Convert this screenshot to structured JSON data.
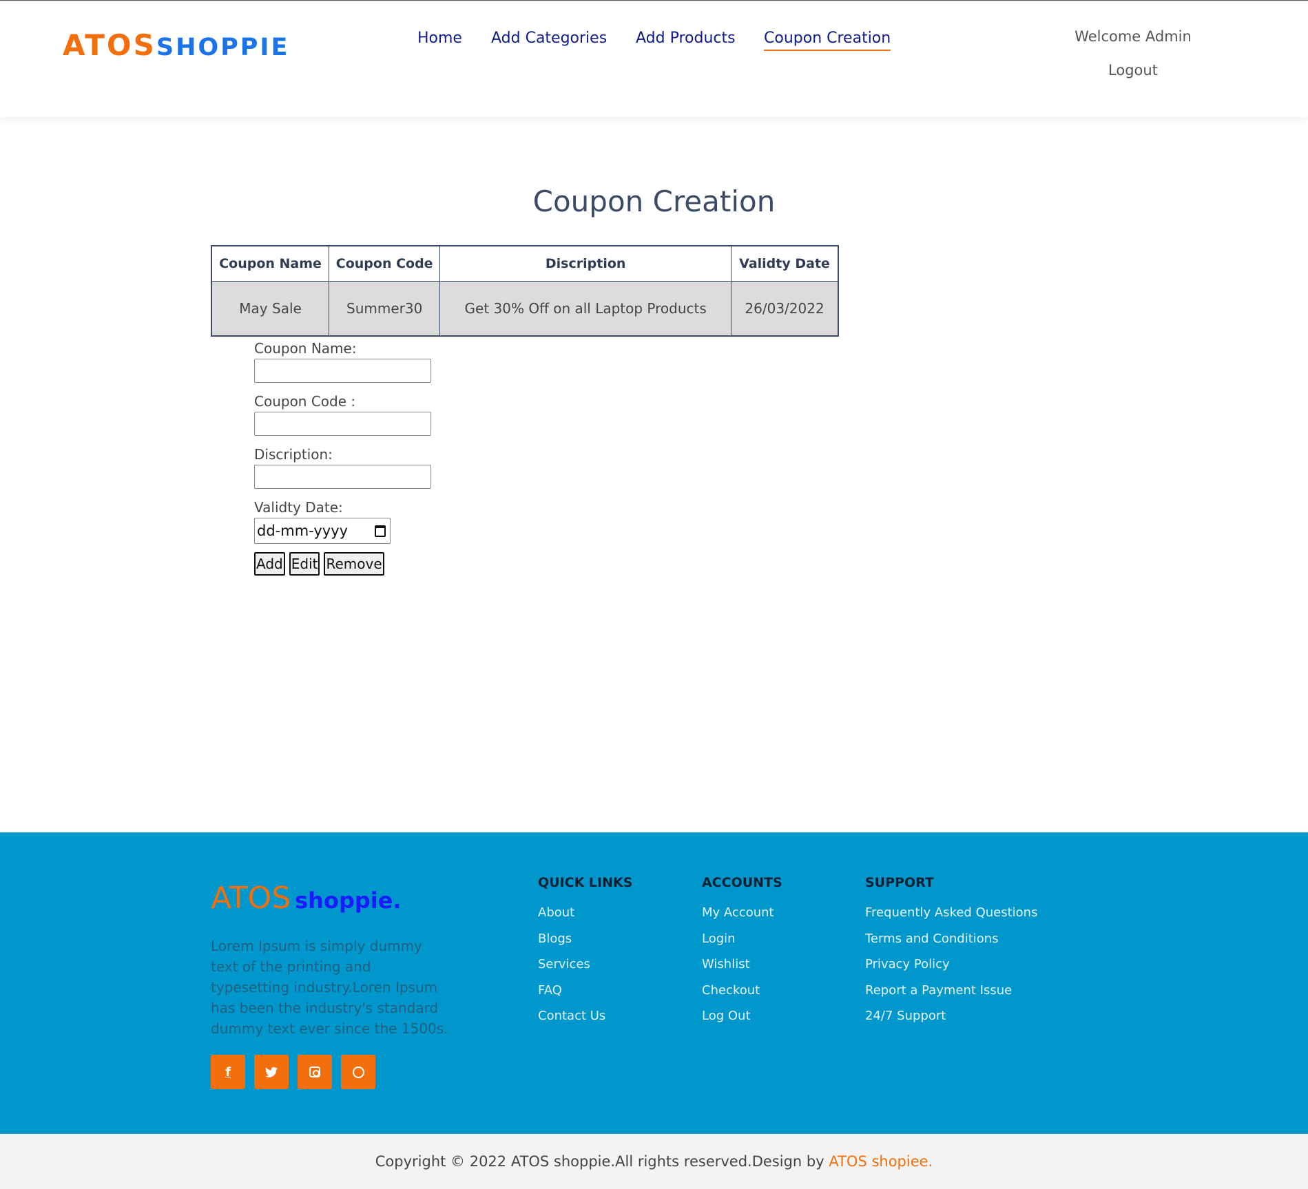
{
  "header": {
    "logo_atos": "ATOS",
    "logo_shoppie": "SHOPPIE",
    "nav": [
      {
        "label": "Home",
        "active": false
      },
      {
        "label": "Add Categories",
        "active": false
      },
      {
        "label": "Add Products",
        "active": false
      },
      {
        "label": "Coupon Creation",
        "active": true
      }
    ],
    "welcome": "Welcome Admin",
    "logout": "Logout"
  },
  "main": {
    "title": "Coupon Creation",
    "table": {
      "headers": [
        "Coupon Name",
        "Coupon Code",
        "Discription",
        "Validty Date"
      ],
      "rows": [
        [
          "May Sale",
          "Summer30",
          "Get 30% Off on all Laptop Products",
          "26/03/2022"
        ]
      ]
    },
    "form": {
      "coupon_name_label": "Coupon Name:",
      "coupon_name_value": "",
      "coupon_code_label": "Coupon Code :",
      "coupon_code_value": "",
      "description_label": "Discription:",
      "description_value": "",
      "validity_label": "Validty Date:",
      "validity_placeholder": "dd-mm-yyyy",
      "add_label": "Add",
      "edit_label": "Edit",
      "remove_label": "Remove"
    }
  },
  "footer": {
    "logo_atos": "ATOS",
    "logo_shoppie": "shoppie.",
    "description": "Lorem Ipsum is simply dummy text of the printing and typesetting industry.Loren Ipsum has been the industry's standard dummy text ever since the 1500s.",
    "socials": [
      {
        "icon": "facebook-icon",
        "glyph": "f"
      },
      {
        "icon": "twitter-icon",
        "glyph": ""
      },
      {
        "icon": "instagram-icon",
        "glyph": ""
      },
      {
        "icon": "whatsapp-icon",
        "glyph": ""
      }
    ],
    "columns": [
      {
        "title": "QUICK LINKS",
        "links": [
          "About",
          "Blogs",
          "Services",
          "FAQ",
          "Contact Us"
        ]
      },
      {
        "title": "ACCOUNTS",
        "links": [
          "My Account",
          "Login",
          "Wishlist",
          "Checkout",
          "Log Out"
        ]
      },
      {
        "title": "SUPPORT",
        "links": [
          "Frequently Asked Questions",
          "Terms and Conditions",
          "Privacy Policy",
          "Report a Payment Issue",
          "24/7 Support"
        ]
      }
    ],
    "copyright": "Copyright © 2022 ATOS shoppie.All rights reserved.Design by",
    "copyright_brand": "ATOS shopiee."
  },
  "colors": {
    "accent_orange": "#f26f0c",
    "brand_blue": "#1a73e8",
    "nav_blue": "#101b8c",
    "footer_bg": "#0098cc"
  }
}
